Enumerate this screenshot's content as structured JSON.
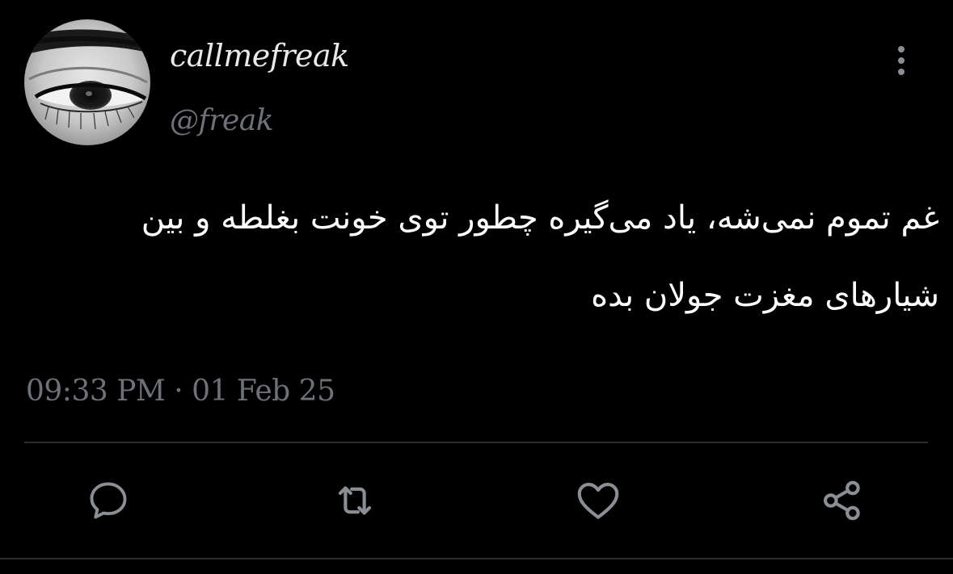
{
  "user": {
    "display_name": "callmefreak",
    "handle": "@freak"
  },
  "tweet": {
    "text": "غم تموم نمی‌شه، یاد می‌گیره چطور توی خونت بغلطه و بین شیارهای مغزت جولان بده",
    "timestamp": "09:33 PM · 01 Feb 25"
  },
  "actions": {
    "reply_icon": "speech-bubble-icon",
    "retweet_icon": "retweet-arrows-icon",
    "like_icon": "heart-icon",
    "share_icon": "share-nodes-icon",
    "more_icon": "vertical-ellipsis-icon"
  },
  "colors": {
    "background": "#000000",
    "primary_text": "#ffffff",
    "secondary_text": "#6e7278",
    "icon": "#8b8f95",
    "divider": "#2b2e32"
  }
}
